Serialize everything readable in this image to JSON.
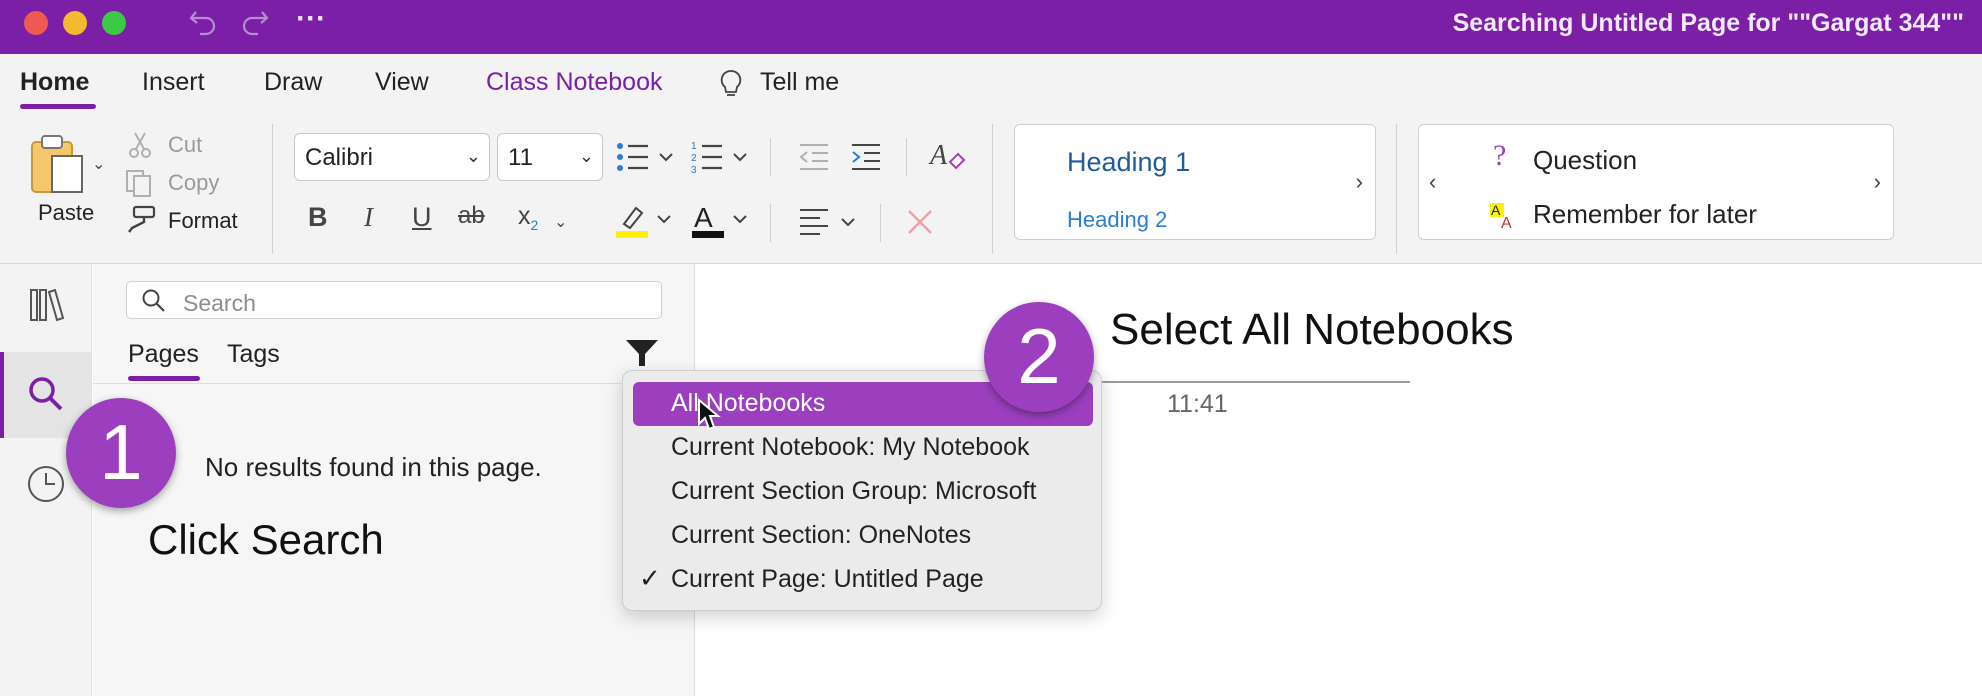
{
  "window": {
    "title": "Searching Untitled Page for \"\"Gargat 344\"\"",
    "more_label": "···"
  },
  "ribbon": {
    "tabs": [
      "Home",
      "Insert",
      "Draw",
      "View",
      "Class Notebook",
      "Tell me"
    ],
    "clipboard": {
      "paste": "Paste",
      "cut": "Cut",
      "copy": "Copy",
      "format": "Format"
    },
    "font_name": "Calibri",
    "font_size": "11",
    "styles": {
      "heading1": "Heading 1",
      "heading2": "Heading 2"
    },
    "tags": {
      "question": "Question",
      "remember": "Remember for later"
    },
    "format_buttons": {
      "bold": "B",
      "italic": "I",
      "underline": "U",
      "strike": "ab",
      "subscript": "x",
      "subscript_small": "2"
    }
  },
  "search_pane": {
    "placeholder": "Search",
    "tabs": [
      "Pages",
      "Tags"
    ],
    "no_results": "No results found in this page."
  },
  "scope_menu": {
    "items": [
      {
        "label": "All Notebooks",
        "highlighted": true,
        "checked": false
      },
      {
        "label": "Current Notebook: My Notebook",
        "highlighted": false,
        "checked": false
      },
      {
        "label": "Current Section Group: Microsoft",
        "highlighted": false,
        "checked": false
      },
      {
        "label": "Current Section: OneNotes",
        "highlighted": false,
        "checked": false
      },
      {
        "label": "Current Page: Untitled Page",
        "highlighted": false,
        "checked": true
      }
    ],
    "check_mark": "✓"
  },
  "annotations": {
    "step1_number": "1",
    "step1_text": "Click Search",
    "step2_number": "2",
    "step2_text": "Select All Notebooks"
  },
  "note": {
    "time": "11:41"
  },
  "colors": {
    "accent": "#7a1fa6",
    "highlight": "#9b3fbf",
    "heading": "#1f5c99"
  }
}
